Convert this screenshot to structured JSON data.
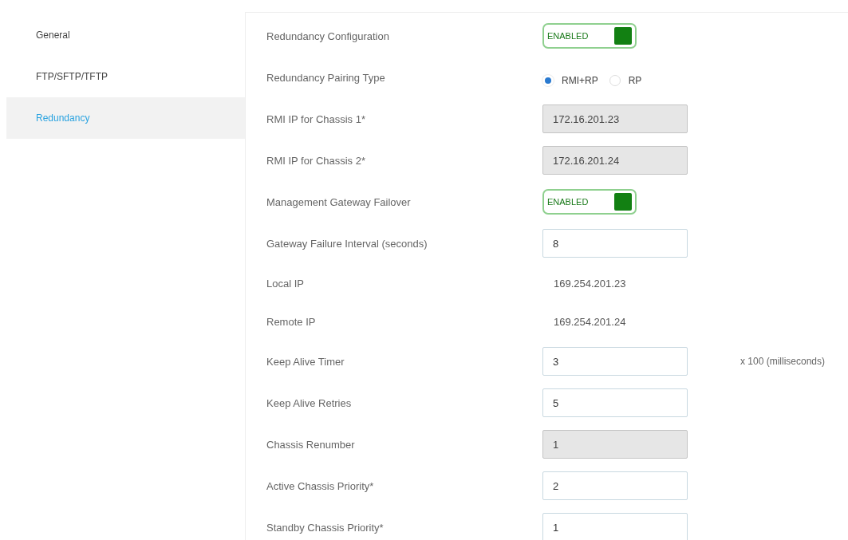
{
  "sidebar": {
    "items": [
      {
        "label": "General",
        "selected": false
      },
      {
        "label": "FTP/SFTP/TFTP",
        "selected": false
      },
      {
        "label": "Redundancy",
        "selected": true
      }
    ]
  },
  "form": {
    "rows": [
      {
        "kind": "toggle",
        "label": "Redundancy Configuration",
        "state_text": "ENABLED",
        "on": true
      },
      {
        "kind": "radio",
        "label": "Redundancy Pairing Type",
        "options": [
          {
            "label": "RMI+RP",
            "selected": true
          },
          {
            "label": "RP",
            "selected": false
          }
        ]
      },
      {
        "kind": "input",
        "label": "RMI IP for Chassis 1*",
        "value": "172.16.201.23",
        "disabled": true
      },
      {
        "kind": "input",
        "label": "RMI IP for Chassis 2*",
        "value": "172.16.201.24",
        "disabled": true
      },
      {
        "kind": "toggle",
        "label": "Management Gateway Failover",
        "state_text": "ENABLED",
        "on": true
      },
      {
        "kind": "input",
        "label": "Gateway Failure Interval (seconds)",
        "value": "8",
        "disabled": false
      },
      {
        "kind": "text",
        "label": "Local IP",
        "value": "169.254.201.23"
      },
      {
        "kind": "text",
        "label": "Remote IP",
        "value": "169.254.201.24"
      },
      {
        "kind": "input",
        "label": "Keep Alive Timer",
        "value": "3",
        "disabled": false,
        "suffix": "x 100 (milliseconds)"
      },
      {
        "kind": "input",
        "label": "Keep Alive Retries",
        "value": "5",
        "disabled": false
      },
      {
        "kind": "input",
        "label": "Chassis Renumber",
        "value": "1",
        "disabled": true
      },
      {
        "kind": "input",
        "label": "Active Chassis Priority*",
        "value": "2",
        "disabled": false
      },
      {
        "kind": "input",
        "label": "Standby Chassis Priority*",
        "value": "1",
        "disabled": false
      }
    ]
  }
}
